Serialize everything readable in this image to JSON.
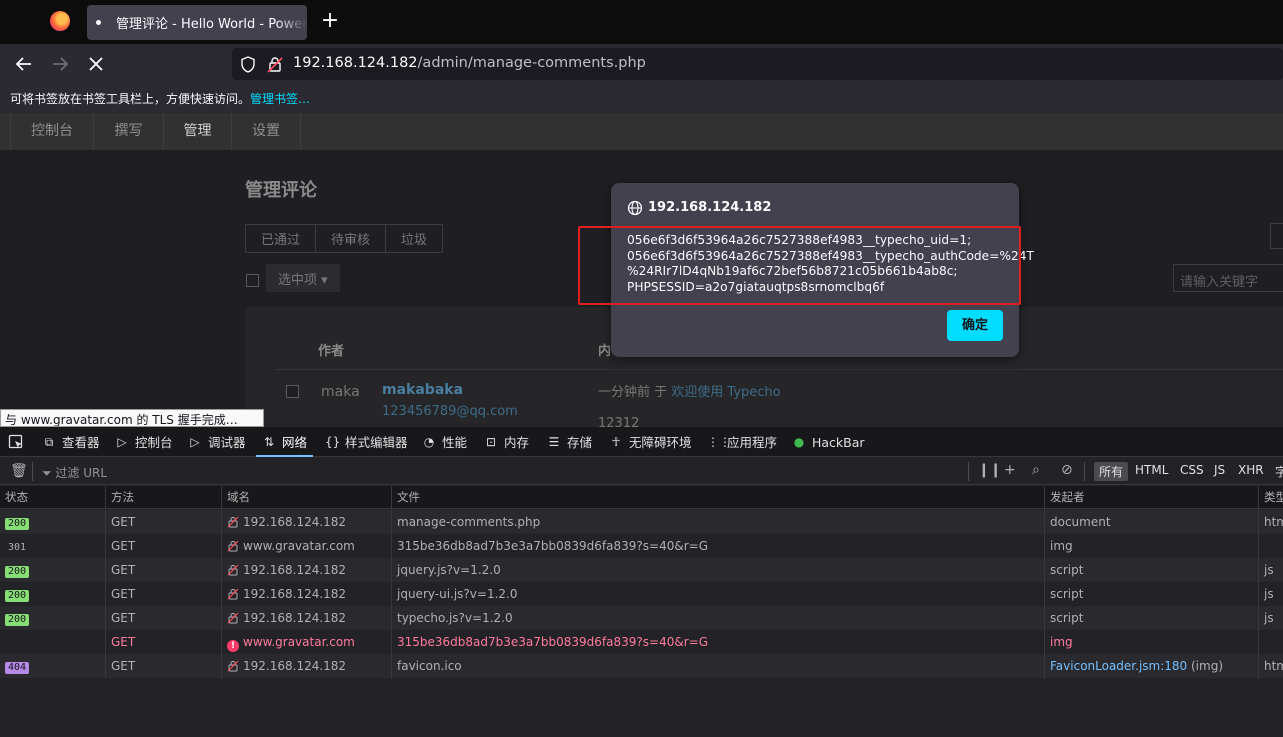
{
  "browser": {
    "tab_title": "管理评论 - Hello World - Powered by Typecho",
    "new_tab_label": "+",
    "url_host": "192.168.124.182",
    "url_path": "/admin/manage-comments.php",
    "bookmarks_hint": "可将书签放在书签工具栏上，方便快速访问。",
    "bookmarks_link": "管理书签…"
  },
  "admin": {
    "nav": [
      "控制台",
      "撰写",
      "管理",
      "设置"
    ],
    "page_title": "管理评论",
    "filters": [
      "已通过",
      "待审核",
      "垃圾"
    ],
    "select_ops": "选中项 ▾",
    "search_placeholder": "请输入关键字",
    "columns": {
      "author": "作者",
      "content": "内"
    },
    "comment": {
      "author_short": "maka",
      "author_name": "makabaka",
      "email": "123456789@qq.com",
      "time": "一分钟前 于",
      "post_link": "欢迎使用 Typecho",
      "text": "12312"
    }
  },
  "dialog": {
    "host": "192.168.124.182",
    "lines": [
      "056e6f3d6f53964a26c7527388ef4983__typecho_uid=1;",
      "056e6f3d6f53964a26c7527388ef4983__typecho_authCode=%24T",
      "%24RIr7lD4qNb19af6c72bef56b8721c05b661b4ab8c;",
      "PHPSESSID=a2o7giatauqtps8srnomclbq6f"
    ],
    "ok_label": "确定"
  },
  "status_tooltip": "与 www.gravatar.com 的 TLS 握手完成…",
  "devtools": {
    "tabs": [
      {
        "icon": "inspector-icon",
        "glyph": "⧉",
        "label": "查看器"
      },
      {
        "icon": "console-icon",
        "glyph": "▷",
        "label": "控制台"
      },
      {
        "icon": "debugger-icon",
        "glyph": "▷",
        "label": "调试器"
      },
      {
        "icon": "network-icon",
        "glyph": "⇅",
        "label": "网络"
      },
      {
        "icon": "style-editor-icon",
        "glyph": "{}",
        "label": "样式编辑器"
      },
      {
        "icon": "performance-icon",
        "glyph": "◔",
        "label": "性能"
      },
      {
        "icon": "memory-icon",
        "glyph": "⊡",
        "label": "内存"
      },
      {
        "icon": "storage-icon",
        "glyph": "☰",
        "label": "存储"
      },
      {
        "icon": "accessibility-icon",
        "glyph": "☥",
        "label": "无障碍环境"
      },
      {
        "icon": "application-icon",
        "glyph": "⋮⋮",
        "label": "应用程序"
      },
      {
        "icon": "hackbar-icon",
        "glyph": "●",
        "label": "HackBar"
      }
    ],
    "filter_placeholder": "过滤 URL",
    "type_filters": [
      "所有",
      "HTML",
      "CSS",
      "JS",
      "XHR",
      "字"
    ],
    "columns": [
      "状态",
      "方法",
      "域名",
      "文件",
      "发起者",
      "类型"
    ],
    "rows": [
      {
        "status": "200",
        "method": "GET",
        "domain": "192.168.124.182",
        "file": "manage-comments.php",
        "initiator": "document",
        "initiator_extra": "",
        "type": "html",
        "error": false
      },
      {
        "status": "301",
        "method": "GET",
        "domain": "www.gravatar.com",
        "file": "315be36db8ad7b3e3a7bb0839d6fa839?s=40&r=G",
        "initiator": "img",
        "initiator_extra": "",
        "type": "",
        "error": false
      },
      {
        "status": "200",
        "method": "GET",
        "domain": "192.168.124.182",
        "file": "jquery.js?v=1.2.0",
        "initiator": "script",
        "initiator_extra": "",
        "type": "js",
        "error": false
      },
      {
        "status": "200",
        "method": "GET",
        "domain": "192.168.124.182",
        "file": "jquery-ui.js?v=1.2.0",
        "initiator": "script",
        "initiator_extra": "",
        "type": "js",
        "error": false
      },
      {
        "status": "200",
        "method": "GET",
        "domain": "192.168.124.182",
        "file": "typecho.js?v=1.2.0",
        "initiator": "script",
        "initiator_extra": "",
        "type": "js",
        "error": false
      },
      {
        "status": "",
        "method": "GET",
        "domain": "www.gravatar.com",
        "file": "315be36db8ad7b3e3a7bb0839d6fa839?s=40&r=G",
        "initiator": "img",
        "initiator_extra": "",
        "type": "",
        "error": true
      },
      {
        "status": "404",
        "method": "GET",
        "domain": "192.168.124.182",
        "file": "favicon.ico",
        "initiator": "FaviconLoader.jsm:180",
        "initiator_extra": " (img)",
        "type": "html",
        "error": false
      }
    ]
  }
}
